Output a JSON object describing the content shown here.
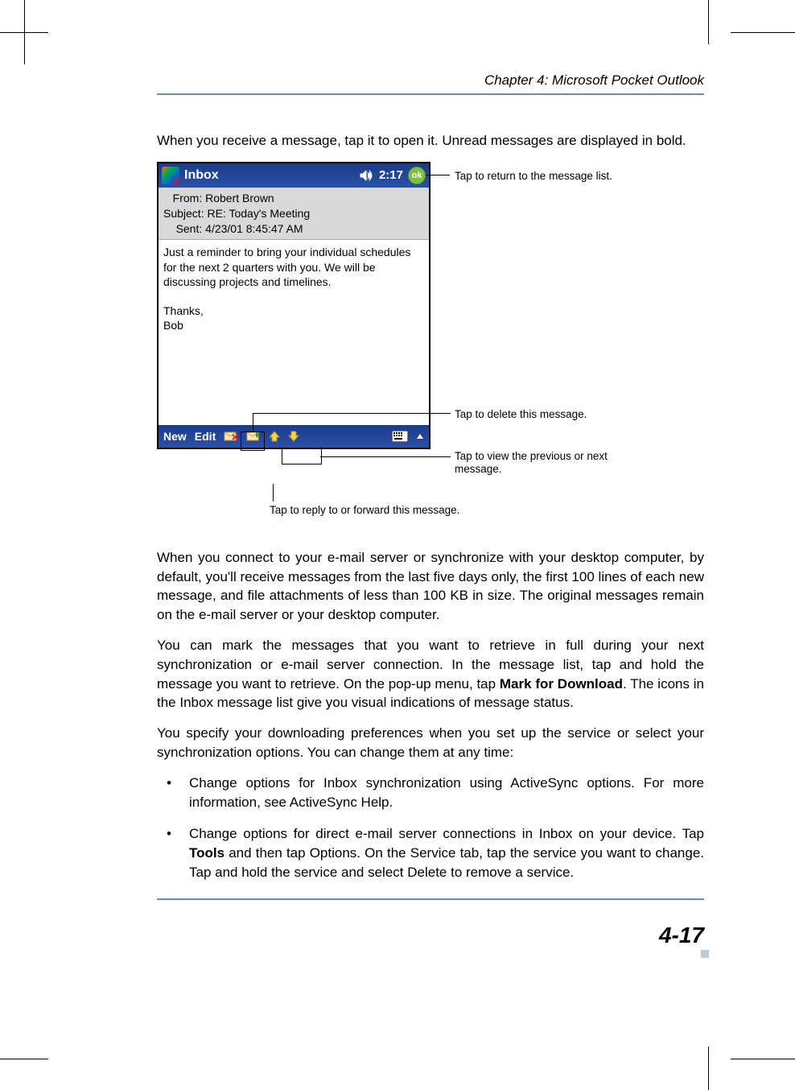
{
  "header": {
    "chapter": "Chapter 4: Microsoft Pocket Outlook"
  },
  "intro": "When you receive a message, tap it to open it. Unread messages are displayed in bold.",
  "screenshot": {
    "titlebar": {
      "title": "Inbox",
      "time": "2:17",
      "ok_label": "ok"
    },
    "meta": {
      "from_label": "From:",
      "from": "Robert Brown",
      "subject_label": "Subject:",
      "subject": "RE: Today's Meeting",
      "sent_label": "Sent:",
      "sent": "4/23/01 8:45:47 AM"
    },
    "body": "Just a reminder to bring your individual schedules for the next 2 quarters with you. We will be discussing projects and timelines.\n\nThanks,\nBob",
    "bottombar": {
      "new": "New",
      "edit": "Edit"
    }
  },
  "callouts": {
    "ok": "Tap to return to the message list.",
    "delete": "Tap to delete this message.",
    "nav": "Tap to view the previous or next message.",
    "reply": "Tap to reply to or forward this message."
  },
  "para1": "When you connect to your e-mail server or synchronize with your desktop computer, by default, you'll receive messages from the last five days only, the first 100 lines of each new message, and file attachments of less than 100 KB in size. The original messages remain on the e-mail server or your desktop computer.",
  "para2_a": "You can mark the messages that you want to retrieve in full during your next synchronization or e-mail server connection. In the message list, tap and hold the message you want to retrieve. On the pop-up menu, tap  ",
  "para2_bold": "Mark for Download",
  "para2_b": ". The icons in the Inbox message list give you visual indications of message status.",
  "para3": "You specify your downloading preferences when you set up the service or select your synchronization options. You can change them at any time:",
  "bullet1": "Change options for Inbox synchronization using ActiveSync options. For more information, see ActiveSync Help.",
  "bullet2_a": "Change options for direct e-mail server connections in Inbox on your device. Tap ",
  "bullet2_bold": "Tools",
  "bullet2_b": "  and then tap Options. On the  Service  tab, tap the service you want to change. Tap and hold the service and select  Delete  to remove a service.",
  "pagenum": "4-17"
}
